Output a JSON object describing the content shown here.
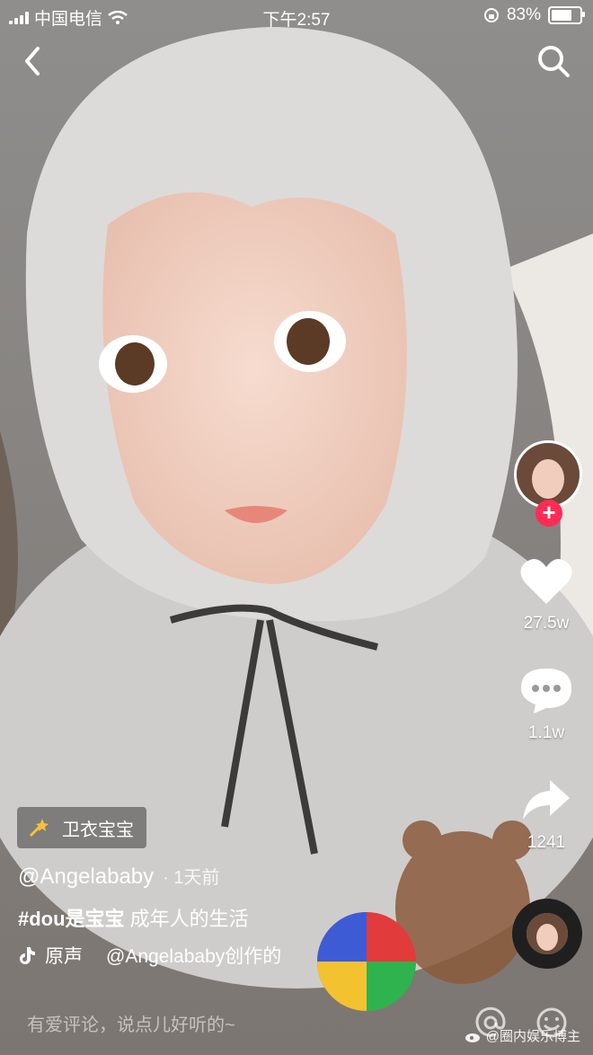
{
  "status_bar": {
    "carrier": "中国电信",
    "time": "下午2:57",
    "battery": "83%",
    "battery_level": 0.83
  },
  "top_bar": {
    "back_icon": "chevron-left-icon",
    "search_icon": "search-icon"
  },
  "rail": {
    "likes": "27.5w",
    "comments": "1.1w",
    "shares": "1241"
  },
  "video_info": {
    "tag": "卫衣宝宝",
    "author": "@Angelababy",
    "time": "· 1天前",
    "caption_hashtag": "#dou是宝宝",
    "caption_text": " 成年人的生活",
    "music_original": "原声",
    "music_creator": "@Angelababy创作的"
  },
  "comment_bar": {
    "placeholder": "有爱评论，说点儿好听的~"
  },
  "watermark": "@圈内娱乐博主",
  "colors": {
    "follow": "#fe2c55",
    "hood": "#dcdbd9",
    "background": "#9c9a98"
  }
}
